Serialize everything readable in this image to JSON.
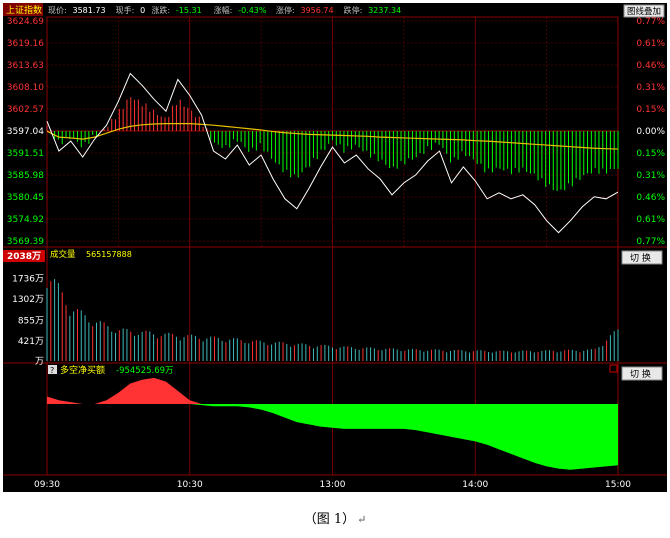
{
  "header": {
    "index_name": "上证指数",
    "fields": [
      {
        "label": "现价:",
        "value": "3581.73",
        "color": "#ffffff"
      },
      {
        "label": "现手:",
        "value": "0",
        "color": "#ffffff"
      },
      {
        "label": "涨跌:",
        "value": "-15.31",
        "color": "#00ff00"
      },
      {
        "label": "涨幅:",
        "value": "-0.43%",
        "color": "#00ff00"
      },
      {
        "label": "涨停:",
        "value": "3956.74",
        "color": "#ff3333"
      },
      {
        "label": "跌停:",
        "value": "3237.34",
        "color": "#00ff00"
      }
    ],
    "overlay_button": "图线叠加"
  },
  "volume_panel": {
    "title": "成交量",
    "total": "565157888",
    "current_marker": "2038万",
    "button": "切 换"
  },
  "flow_panel": {
    "help_glyph": "?",
    "title": "多空净买额",
    "value": "-954525.69万",
    "button": "切 换"
  },
  "caption": {
    "text": "（图 1）",
    "return_mark": "↵"
  },
  "colors": {
    "background": "#000000",
    "up": "#ff3333",
    "down": "#00ff00",
    "price_line": "#ffffff",
    "avg_line": "#e8c000",
    "volume_bar": "#3fb8b8",
    "grid": "#8b0000"
  },
  "chart_data": [
    {
      "type": "line",
      "name": "price",
      "y_ticks": [
        "3624.69",
        "3619.16",
        "3613.63",
        "3608.10",
        "3602.57",
        "3597.04",
        "3591.51",
        "3585.98",
        "3580.45",
        "3574.92",
        "3569.39"
      ],
      "pct_ticks": [
        "0.77%",
        "0.61%",
        "0.46%",
        "0.31%",
        "0.15%",
        "0.00%",
        "0.15%",
        "0.31%",
        "0.46%",
        "0.61%",
        "0.77%"
      ],
      "x_ticks": [
        "09:30",
        "10:30",
        "13:00",
        "14:00",
        "15:00"
      ],
      "ylim": [
        3569.39,
        3624.69
      ],
      "reference": 3597.04,
      "x": [
        0,
        5,
        10,
        15,
        20,
        25,
        30,
        35,
        40,
        45,
        50,
        55,
        60,
        65,
        70,
        75,
        80,
        85,
        90,
        95,
        100,
        105,
        110,
        115,
        120,
        125,
        130,
        135,
        140,
        145,
        150,
        155,
        160,
        165,
        170,
        175,
        180,
        185,
        190,
        195,
        200,
        205,
        210,
        215,
        220,
        225,
        230,
        235,
        240
      ],
      "price": [
        3599.5,
        3592.0,
        3594.5,
        3590.5,
        3595.0,
        3598.5,
        3604.5,
        3611.5,
        3608.5,
        3605.0,
        3602.0,
        3610.0,
        3606.0,
        3601.0,
        3592.0,
        3590.0,
        3593.5,
        3588.5,
        3591.0,
        3585.0,
        3580.0,
        3577.5,
        3582.5,
        3588.0,
        3593.0,
        3589.0,
        3591.0,
        3587.5,
        3585.0,
        3581.0,
        3584.0,
        3586.0,
        3589.5,
        3592.0,
        3584.0,
        3588.0,
        3584.5,
        3580.0,
        3581.5,
        3580.0,
        3581.0,
        3578.5,
        3574.5,
        3571.5,
        3574.5,
        3578.0,
        3580.5,
        3580.0,
        3581.7
      ],
      "avg": [
        3597.0,
        3595.5,
        3595.3,
        3595.0,
        3595.5,
        3596.5,
        3597.5,
        3598.2,
        3598.6,
        3598.8,
        3598.9,
        3598.9,
        3598.9,
        3598.7,
        3598.5,
        3598.2,
        3597.9,
        3597.6,
        3597.3,
        3596.9,
        3596.6,
        3596.4,
        3596.2,
        3596.1,
        3596.0,
        3595.9,
        3595.8,
        3595.7,
        3595.5,
        3595.4,
        3595.3,
        3595.2,
        3595.1,
        3595.0,
        3594.9,
        3594.8,
        3594.6,
        3594.5,
        3594.3,
        3594.1,
        3593.9,
        3593.7,
        3593.5,
        3593.3,
        3593.1,
        3592.9,
        3592.7,
        3592.6,
        3592.5
      ]
    },
    {
      "type": "bar",
      "name": "volume",
      "unit": "万",
      "y_ticks": [
        "1736万",
        "1302万",
        "855万",
        "421万",
        "万"
      ],
      "ylim": [
        0,
        2170
      ],
      "x": [
        0,
        10,
        20,
        30,
        40,
        50,
        60,
        70,
        80,
        90,
        100,
        110,
        120,
        130,
        140,
        150,
        160,
        170,
        180,
        190,
        200,
        210,
        220,
        230,
        240
      ],
      "values": [
        2050,
        1200,
        900,
        700,
        650,
        600,
        560,
        520,
        480,
        430,
        400,
        360,
        330,
        300,
        280,
        260,
        250,
        240,
        230,
        220,
        220,
        230,
        240,
        250,
        700
      ]
    },
    {
      "type": "area",
      "name": "多空净买额",
      "unit": "万",
      "x": [
        0,
        5,
        10,
        15,
        20,
        25,
        30,
        35,
        40,
        45,
        50,
        55,
        60,
        65,
        70,
        75,
        80,
        85,
        90,
        95,
        100,
        105,
        110,
        115,
        120,
        125,
        130,
        135,
        140,
        145,
        150,
        155,
        160,
        165,
        170,
        175,
        180,
        185,
        190,
        195,
        200,
        205,
        210,
        215,
        220,
        225,
        230,
        235,
        240
      ],
      "values": [
        4,
        2,
        1,
        0,
        0,
        2,
        6,
        11,
        13,
        14,
        12,
        7,
        2,
        -1,
        -2,
        -2,
        -2,
        -3,
        -5,
        -8,
        -12,
        -16,
        -18,
        -20,
        -21,
        -22,
        -22,
        -22,
        -22,
        -22,
        -22,
        -23,
        -25,
        -27,
        -29,
        -31,
        -33,
        -36,
        -40,
        -44,
        -48,
        -52,
        -55,
        -57,
        -58,
        -57,
        -56,
        -55,
        -54
      ],
      "ylim": [
        -60,
        15
      ]
    }
  ]
}
